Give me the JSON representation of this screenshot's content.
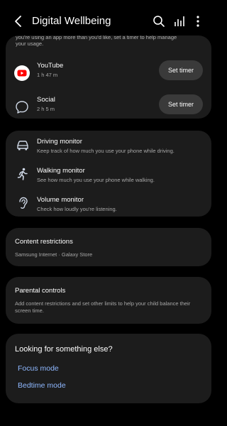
{
  "header": {
    "title": "Digital Wellbeing",
    "back_icon": "back-arrow-icon",
    "search_icon": "search-icon",
    "stats_icon": "bar-chart-icon",
    "more_icon": "more-vert-icon"
  },
  "app_timers": {
    "cut_text_line1": "you're using an app more than you'd like, set a timer to help manage",
    "cut_text_line2": "your usage.",
    "apps": [
      {
        "name": "YouTube",
        "time": "1 h 47 m",
        "button": "Set timer",
        "icon": "youtube-icon",
        "icon_color": "#ff0000"
      },
      {
        "name": "Social",
        "time": "2 h 5 m",
        "button": "Set timer",
        "icon": "chat-bubble-icon"
      }
    ]
  },
  "tools": [
    {
      "title": "Driving monitor",
      "desc": "Keep track of how much you use your phone while driving.",
      "icon": "car-icon"
    },
    {
      "title": "Walking monitor",
      "desc": "See how much you use your phone while walking.",
      "icon": "walking-person-icon"
    },
    {
      "title": "Volume monitor",
      "desc": "Check how loudly you're listening.",
      "icon": "ear-icon"
    }
  ],
  "content_restrictions": {
    "title": "Content restrictions",
    "subtitle": "Samsung Internet · Galaxy Store"
  },
  "parental_controls": {
    "title": "Parental controls",
    "desc": "Add content restrictions and set other limits to help your child balance their screen time."
  },
  "looking": {
    "title": "Looking for something else?",
    "links": [
      "Focus mode",
      "Bedtime mode"
    ]
  },
  "colors": {
    "background": "#000000",
    "card": "#1c1c1c",
    "button": "#3a3a3a",
    "link": "#8fb8ff"
  }
}
